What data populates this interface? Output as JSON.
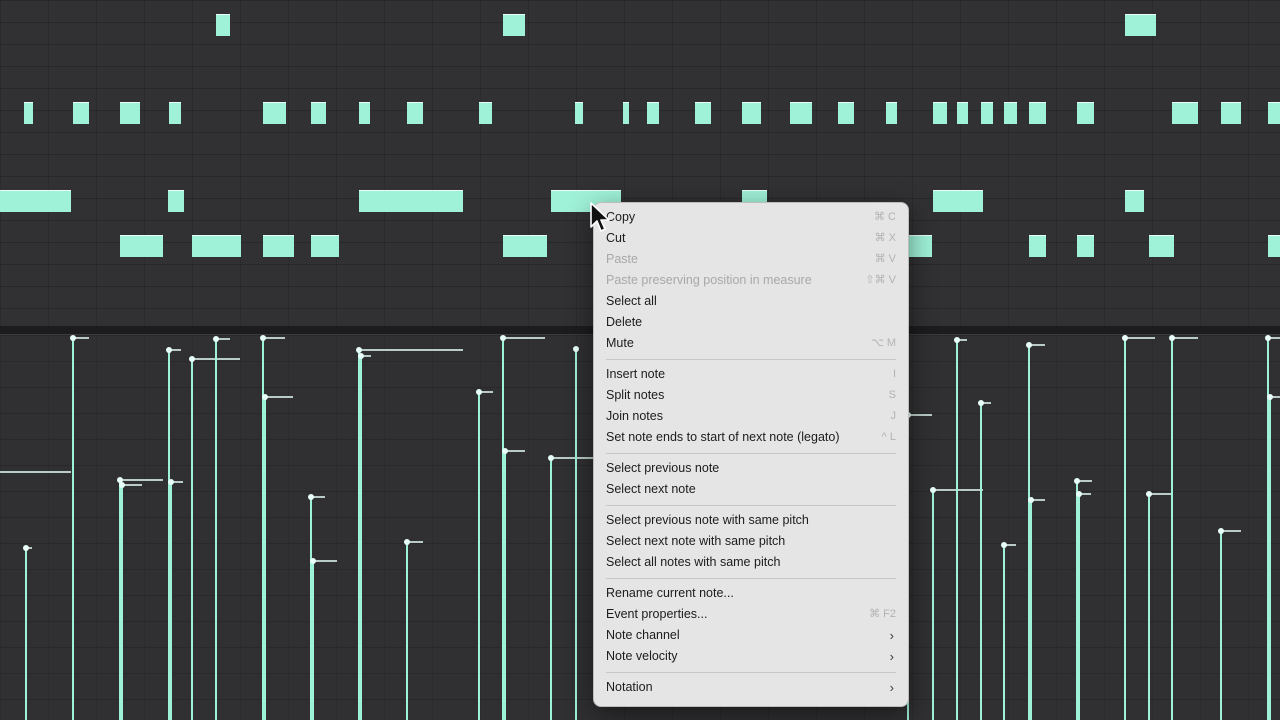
{
  "context_menu": {
    "groups": [
      [
        {
          "label": "Copy",
          "shortcut": "⌘ C",
          "disabled": false
        },
        {
          "label": "Cut",
          "shortcut": "⌘ X",
          "disabled": false
        },
        {
          "label": "Paste",
          "shortcut": "⌘ V",
          "disabled": true
        },
        {
          "label": "Paste preserving position in measure",
          "shortcut": "⇧⌘ V",
          "disabled": true
        },
        {
          "label": "Select all",
          "shortcut": "",
          "disabled": false
        },
        {
          "label": "Delete",
          "shortcut": "",
          "disabled": false
        },
        {
          "label": "Mute",
          "shortcut": "⌥ M",
          "disabled": false
        }
      ],
      [
        {
          "label": "Insert note",
          "shortcut": "I",
          "disabled": false
        },
        {
          "label": "Split notes",
          "shortcut": "S",
          "disabled": false
        },
        {
          "label": "Join notes",
          "shortcut": "J",
          "disabled": false
        },
        {
          "label": "Set note ends to start of next note (legato)",
          "shortcut": "^ L",
          "disabled": false
        }
      ],
      [
        {
          "label": "Select previous note",
          "shortcut": "",
          "disabled": false
        },
        {
          "label": "Select next note",
          "shortcut": "",
          "disabled": false
        }
      ],
      [
        {
          "label": "Select previous note with same pitch",
          "shortcut": "",
          "disabled": false
        },
        {
          "label": "Select next note with same pitch",
          "shortcut": "",
          "disabled": false
        },
        {
          "label": "Select all notes with same pitch",
          "shortcut": "",
          "disabled": false
        }
      ],
      [
        {
          "label": "Rename current note...",
          "shortcut": "",
          "disabled": false
        },
        {
          "label": "Event properties...",
          "shortcut": "⌘ F2",
          "disabled": false
        },
        {
          "label": "Note channel",
          "shortcut": "",
          "submenu": true,
          "disabled": false
        },
        {
          "label": "Note velocity",
          "shortcut": "",
          "submenu": true,
          "disabled": false
        }
      ],
      [
        {
          "label": "Notation",
          "shortcut": "",
          "submenu": true,
          "disabled": false
        }
      ]
    ]
  },
  "note_color": "#9ff1d8",
  "menu_background": "#e6e5e5",
  "submenu_glyph": "›"
}
